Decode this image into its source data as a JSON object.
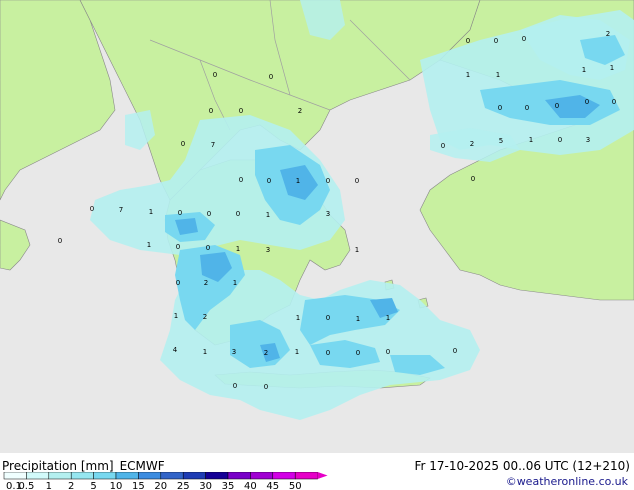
{
  "title": {
    "label": "Precipitation [mm]",
    "model": "ECMWF"
  },
  "valid": "Fr 17-10-2025 00..06 UTC (12+210)",
  "credit": "©weatheronline.co.uk",
  "colors": {
    "sea": "#e8e8e8",
    "land": "#c8f0a0",
    "border": "#a0a0a0",
    "coast": "#888888",
    "precip_light": "#b4f0f0",
    "precip_mid": "#78d8f0",
    "precip_heavy": "#50b4e8",
    "precip_max": "#3c8ce0"
  },
  "legend": {
    "labels": [
      "0.1",
      "0.5",
      "1",
      "2",
      "5",
      "10",
      "15",
      "20",
      "25",
      "30",
      "35",
      "40",
      "45",
      "50"
    ],
    "colors": [
      "#f0ffff",
      "#d2fafa",
      "#b4f0f0",
      "#96e6f0",
      "#78d8f0",
      "#50b4e8",
      "#3c8ce0",
      "#3264c8",
      "#1e3cb4",
      "#140096",
      "#7800c8",
      "#a000d2",
      "#d200e6",
      "#e600c8"
    ]
  },
  "values": [
    "0",
    "0",
    "0",
    "2",
    "1",
    "1",
    "1",
    "1",
    "0",
    "0",
    "0",
    "0",
    "0",
    "0",
    "2",
    "5",
    "1",
    "0",
    "3",
    "0",
    "0",
    "0",
    "0",
    "0",
    "2",
    "0",
    "7",
    "0",
    "0",
    "1",
    "0",
    "0",
    "0",
    "7",
    "1",
    "0",
    "0",
    "0",
    "1",
    "3",
    "0",
    "1",
    "0",
    "0",
    "1",
    "3",
    "1",
    "0",
    "2",
    "1",
    "1",
    "2",
    "1",
    "0",
    "1",
    "1",
    "4",
    "1",
    "3",
    "2",
    "1",
    "0",
    "0",
    "0",
    "0",
    "0",
    "0"
  ]
}
